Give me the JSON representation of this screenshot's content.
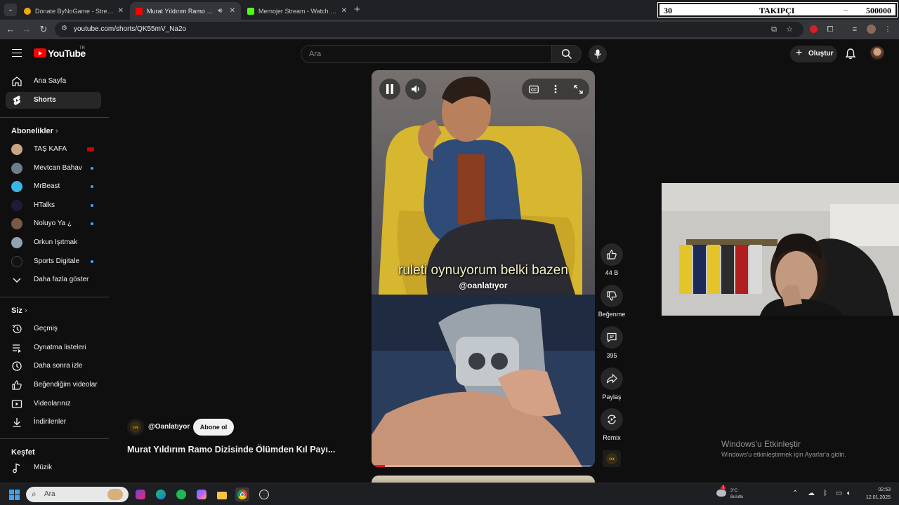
{
  "browser": {
    "tabs": [
      {
        "title": "Donate ByNoGame - Streamer",
        "active": false
      },
      {
        "title": "Murat Yıldırım Ramo Dizisi",
        "active": true
      },
      {
        "title": "Memojer Stream - Watch Live",
        "active": false
      }
    ],
    "url": "youtube.com/shorts/QK55mV_Na2o"
  },
  "overlay": {
    "follower_count": "30",
    "label": "TAKIPÇI",
    "goal": "500000"
  },
  "youtube": {
    "logo_text": "YouTube",
    "region": "TR",
    "search_placeholder": "Ara",
    "create_label": "Oluştur"
  },
  "sidebar": {
    "main": [
      {
        "label": "Ana Sayfa",
        "icon": "home-icon",
        "active": false
      },
      {
        "label": "Shorts",
        "icon": "shorts-icon",
        "active": true
      }
    ],
    "subs_heading": "Abonelikler",
    "subscriptions": [
      {
        "name": "TAŞ KAFA",
        "color": "#c9a586",
        "indicator": "live"
      },
      {
        "name": "Mevtcan Bahav",
        "color": "#6b7f8a",
        "indicator": "new"
      },
      {
        "name": "MrBeast",
        "color": "#38b6e6",
        "indicator": "new"
      },
      {
        "name": "HTalks",
        "color": "#1c1c3a",
        "indicator": "new"
      },
      {
        "name": "Noluyo Ya ¿",
        "color": "#7a5a45",
        "indicator": "new"
      },
      {
        "name": "Orkun Işıtmak",
        "color": "#8fa3b0",
        "indicator": "none"
      },
      {
        "name": "Sports Digitale",
        "color": "#111111",
        "indicator": "new"
      }
    ],
    "show_more": "Daha fazla göster",
    "you_heading": "Siz",
    "you": [
      {
        "label": "Geçmiş",
        "icon": "history-icon"
      },
      {
        "label": "Oynatma listeleri",
        "icon": "playlists-icon"
      },
      {
        "label": "Daha sonra izle",
        "icon": "watch-later-icon"
      },
      {
        "label": "Beğendiğim videolar",
        "icon": "liked-icon"
      },
      {
        "label": "Videolarınız",
        "icon": "your-videos-icon"
      },
      {
        "label": "İndirilenler",
        "icon": "downloads-icon"
      }
    ],
    "explore_heading": "Keşfet",
    "explore": [
      {
        "label": "Müzik",
        "icon": "music-icon"
      }
    ]
  },
  "short": {
    "subtitle": "ruleti oynuyorum belki bazen",
    "watermark": "@oanlatıyor",
    "channel": "@Oanlatıyor",
    "subscribe_label": "Abone ol",
    "title": "Murat Yıldırım Ramo Dizisinde Ölümden Kıl Payı...",
    "progress": 0.06,
    "actions": {
      "likes": "44 B",
      "dislike": "Beğenme",
      "comments": "395",
      "share": "Paylaş",
      "remix": "Remix"
    }
  },
  "windows": {
    "activate_title": "Windows'u Etkinleştir",
    "activate_sub": "Windows'u etkinleştirmek için Ayarlar'a gidin.",
    "search": "Ara",
    "weather_temp": "3°C",
    "weather_desc": "Bulutlu",
    "notif_badge": "7",
    "time": "02:53",
    "date": "12.01.2025"
  }
}
